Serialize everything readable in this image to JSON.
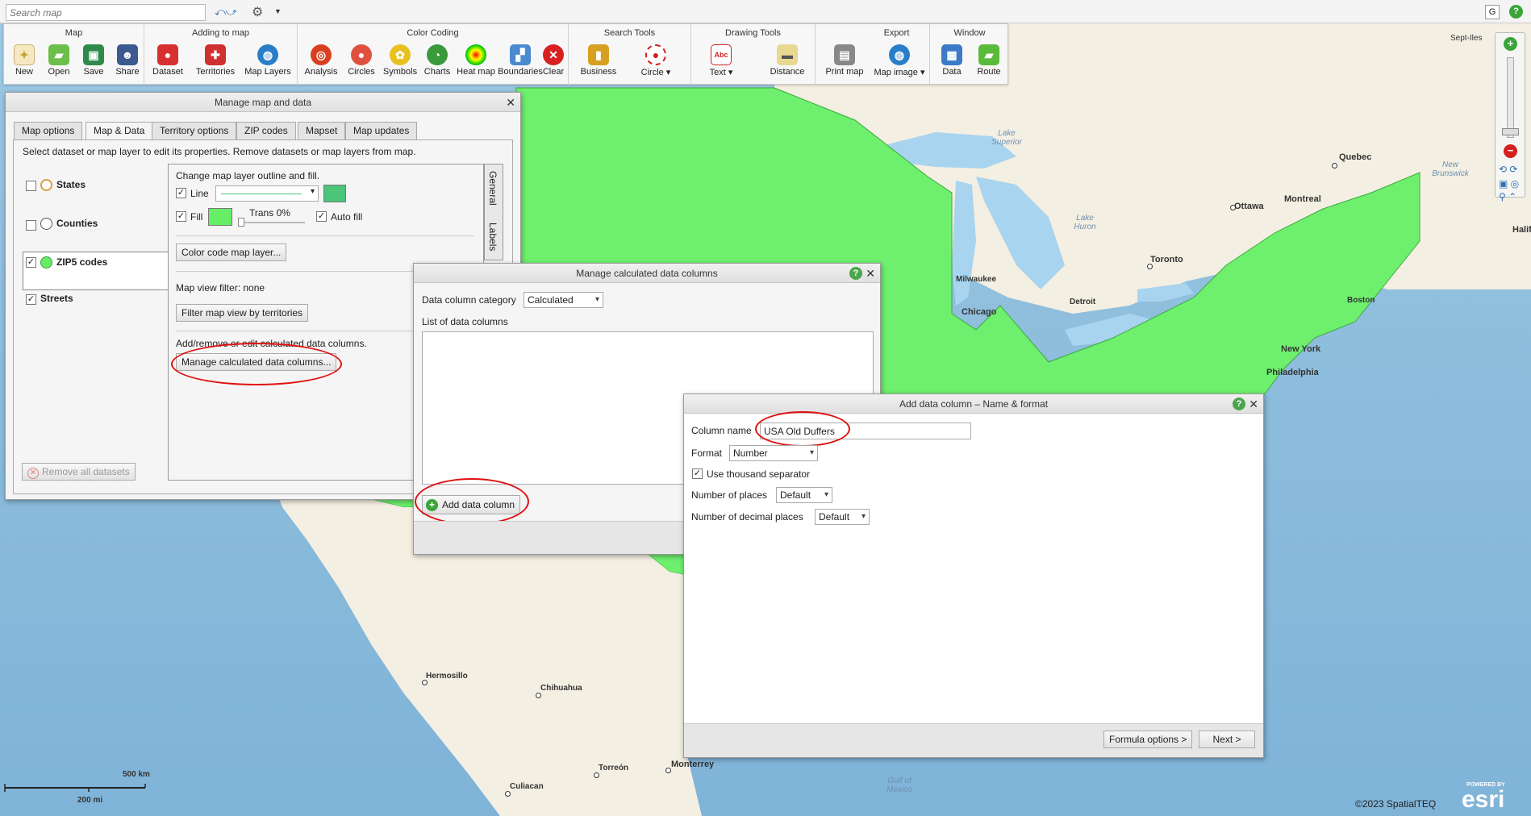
{
  "search": {
    "placeholder": "Search map"
  },
  "topright": {
    "g_label": "G",
    "help_label": "?"
  },
  "ribbon": {
    "groups": [
      {
        "title": "Map",
        "items": [
          "New",
          "Open",
          "Save",
          "Share"
        ]
      },
      {
        "title": "Adding to map",
        "items": [
          "Dataset",
          "Territories",
          "Map Layers"
        ]
      },
      {
        "title": "Color Coding",
        "items": [
          "Analysis",
          "Circles",
          "Symbols",
          "Charts",
          "Heat map",
          "Boundaries",
          "Clear"
        ]
      },
      {
        "title": "Search Tools",
        "items": [
          "Business",
          "Circle ▾"
        ]
      },
      {
        "title": "Drawing Tools",
        "items": [
          "Text ▾",
          "Distance"
        ]
      },
      {
        "title": "Export",
        "items": [
          "Print map",
          "Map image ▾"
        ]
      },
      {
        "title": "Window",
        "items": [
          "Data",
          "Route"
        ]
      }
    ]
  },
  "manage": {
    "title": "Manage map and data",
    "tabs": [
      "Map options",
      "Map & Data",
      "Territory options",
      "ZIP codes",
      "Mapset",
      "Map updates"
    ],
    "instructions": "Select dataset or map layer to edit its properties. Remove datasets or map layers from map.",
    "layers": [
      "States",
      "Counties",
      "ZIP5 codes",
      "Streets"
    ],
    "outline_label": "Change map layer outline and fill.",
    "line_label": "Line",
    "fill_label": "Fill",
    "trans_label": "Trans 0%",
    "autofill_label": "Auto fill",
    "color_code_btn": "Color code map layer...",
    "filter_text": "Map view filter: none",
    "filter_btn": "Filter map view by territories",
    "calc_text": "Add/remove or edit calculated data columns.",
    "calc_btn": "Manage calculated data columns...",
    "side_tabs": [
      "General",
      "Labels"
    ],
    "remove_btn": "Remove all datasets",
    "colors": {
      "fill": "#66ee66",
      "line": "#4cc47a"
    }
  },
  "calc": {
    "title": "Manage calculated data columns",
    "category_label": "Data column category",
    "category_value": "Calculated",
    "list_label": "List of data columns",
    "add_btn": "Add data column"
  },
  "add": {
    "title": "Add data column – Name & format",
    "name_label": "Column name",
    "name_value": "USA Old Duffers",
    "format_label": "Format",
    "format_value": "Number",
    "thousand_label": "Use thousand separator",
    "places_label": "Number of places",
    "places_value": "Default",
    "decimal_label": "Number of decimal places",
    "decimal_value": "Default",
    "formula_btn": "Formula options >",
    "next_btn": "Next >"
  },
  "map": {
    "cities": [
      "Sept-Iles",
      "Quebec",
      "Ottawa",
      "Montreal",
      "New Brunswick",
      "Halifax",
      "Toronto",
      "Milwaukee",
      "Chicago",
      "Detroit",
      "Boston",
      "New York",
      "Philadelphia",
      "Hermosillo",
      "Chihuahua",
      "Torreón",
      "Monterrey",
      "Culiacan"
    ],
    "water": [
      "Lake Superior",
      "Lake Huron",
      "Gulf of Mexico"
    ],
    "scale_km": "500 km",
    "scale_mi": "200 mi",
    "copyright": "©2023 SpatialTEQ",
    "esri_powered": "POWERED BY",
    "esri": "esri",
    "land_color": "#6ef06e"
  }
}
